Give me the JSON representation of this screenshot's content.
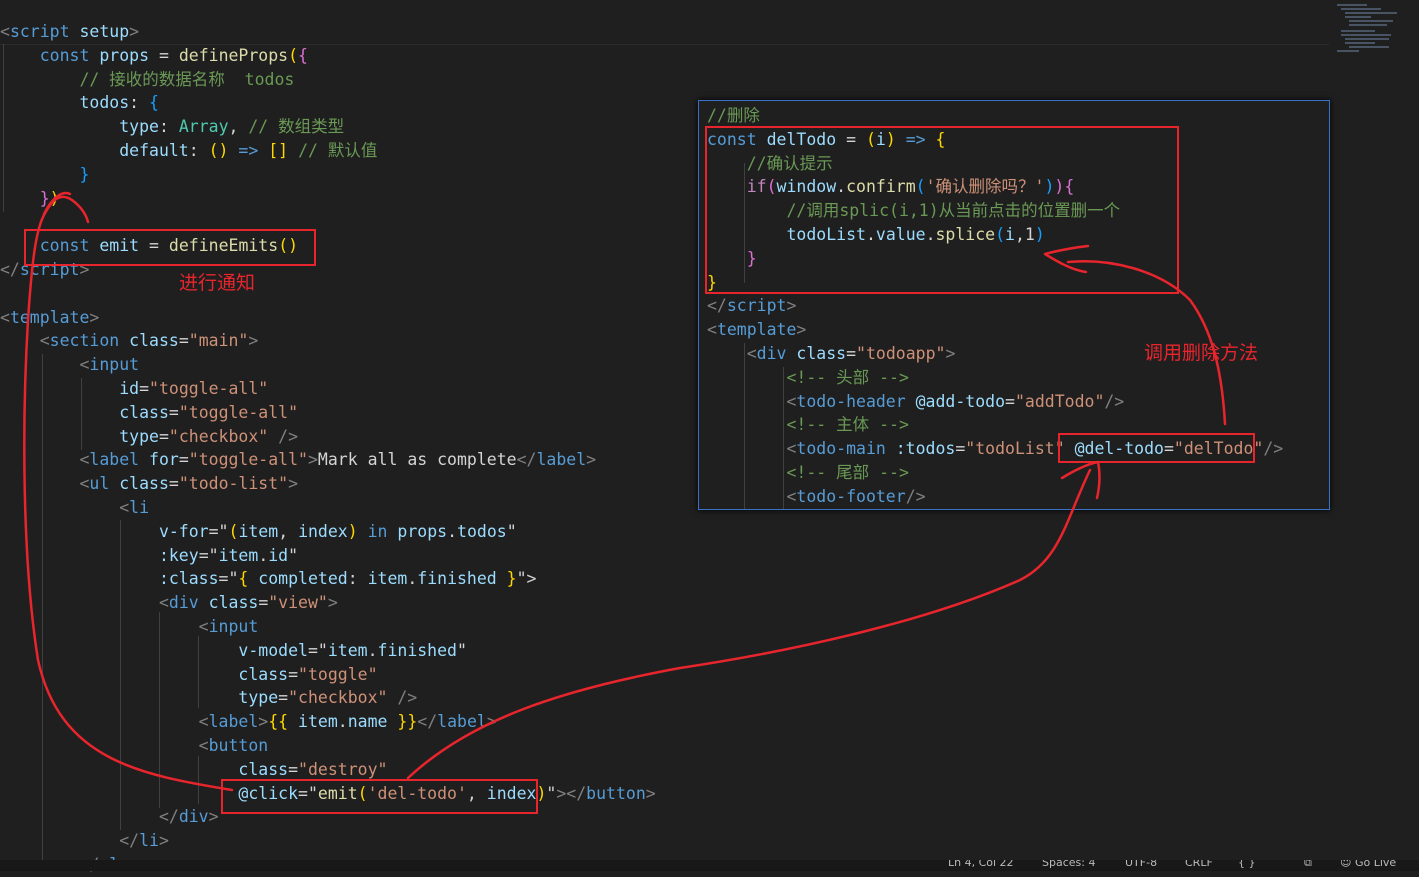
{
  "editor": {
    "lines": [
      [
        [
          "<",
          "c-tag"
        ],
        [
          "script",
          "c-tagname"
        ],
        [
          " ",
          "c-txt"
        ],
        [
          "setup",
          "c-attr"
        ],
        [
          ">",
          "c-tag"
        ]
      ],
      [
        [
          "    const ",
          "c-kw"
        ],
        [
          "props",
          "c-var"
        ],
        [
          " = ",
          "c-txt"
        ],
        [
          "defineProps",
          "c-fn"
        ],
        [
          "(",
          "c-br1"
        ],
        [
          "{",
          "c-br2"
        ]
      ],
      [
        [
          "        // 接收的数据名称  todos",
          "c-com"
        ]
      ],
      [
        [
          "        todos",
          "c-var"
        ],
        [
          ": ",
          "c-txt"
        ],
        [
          "{",
          "c-br3"
        ]
      ],
      [
        [
          "            type",
          "c-var"
        ],
        [
          ": ",
          "c-txt"
        ],
        [
          "Array",
          "c-cls"
        ],
        [
          ", ",
          "c-txt"
        ],
        [
          "// 数组类型",
          "c-com"
        ]
      ],
      [
        [
          "            default",
          "c-var"
        ],
        [
          ": ",
          "c-txt"
        ],
        [
          "()",
          "c-br1"
        ],
        [
          " => ",
          "c-kw"
        ],
        [
          "[]",
          "c-br1"
        ],
        [
          " ",
          "c-txt"
        ],
        [
          "// 默认值",
          "c-com"
        ]
      ],
      [
        [
          "        }",
          "c-br3"
        ]
      ],
      [
        [
          "    }",
          "c-br2"
        ],
        [
          ")",
          "c-br1"
        ]
      ],
      [
        [
          "",
          "c-txt"
        ]
      ],
      [
        [
          "    const ",
          "c-kw"
        ],
        [
          "emit",
          "c-var"
        ],
        [
          " = ",
          "c-txt"
        ],
        [
          "defineEmits",
          "c-fn"
        ],
        [
          "()",
          "c-br1"
        ]
      ],
      [
        [
          "</",
          "c-tag"
        ],
        [
          "script",
          "c-tagname"
        ],
        [
          ">",
          "c-tag"
        ]
      ],
      [
        [
          "",
          "c-txt"
        ]
      ],
      [
        [
          "<",
          "c-tag"
        ],
        [
          "template",
          "c-tagname"
        ],
        [
          ">",
          "c-tag"
        ]
      ],
      [
        [
          "    <",
          "c-tag"
        ],
        [
          "section",
          "c-tagname"
        ],
        [
          " class",
          "c-attr"
        ],
        [
          "=",
          "c-txt"
        ],
        [
          "\"main\"",
          "c-str"
        ],
        [
          ">",
          "c-tag"
        ]
      ],
      [
        [
          "        <",
          "c-tag"
        ],
        [
          "input",
          "c-tagname"
        ]
      ],
      [
        [
          "            id",
          "c-attr"
        ],
        [
          "=",
          "c-txt"
        ],
        [
          "\"toggle-all\"",
          "c-str"
        ]
      ],
      [
        [
          "            class",
          "c-attr"
        ],
        [
          "=",
          "c-txt"
        ],
        [
          "\"toggle-all\"",
          "c-str"
        ]
      ],
      [
        [
          "            type",
          "c-attr"
        ],
        [
          "=",
          "c-txt"
        ],
        [
          "\"checkbox\"",
          "c-str"
        ],
        [
          " />",
          "c-tag"
        ]
      ],
      [
        [
          "        <",
          "c-tag"
        ],
        [
          "label",
          "c-tagname"
        ],
        [
          " for",
          "c-attr"
        ],
        [
          "=",
          "c-txt"
        ],
        [
          "\"toggle-all\"",
          "c-str"
        ],
        [
          ">",
          "c-tag"
        ],
        [
          "Mark all as complete",
          "c-txt"
        ],
        [
          "</",
          "c-tag"
        ],
        [
          "label",
          "c-tagname"
        ],
        [
          ">",
          "c-tag"
        ]
      ],
      [
        [
          "        <",
          "c-tag"
        ],
        [
          "ul",
          "c-tagname"
        ],
        [
          " class",
          "c-attr"
        ],
        [
          "=",
          "c-txt"
        ],
        [
          "\"todo-list\"",
          "c-str"
        ],
        [
          ">",
          "c-tag"
        ]
      ],
      [
        [
          "            <",
          "c-tag"
        ],
        [
          "li",
          "c-tagname"
        ]
      ],
      [
        [
          "                v-for",
          "c-attr"
        ],
        [
          "=\"",
          "c-txt"
        ],
        [
          "(",
          "c-br1"
        ],
        [
          "item",
          "c-var"
        ],
        [
          ", ",
          "c-txt"
        ],
        [
          "index",
          "c-var"
        ],
        [
          ")",
          "c-br1"
        ],
        [
          " in ",
          "c-kw"
        ],
        [
          "props",
          "c-var"
        ],
        [
          ".",
          "c-txt"
        ],
        [
          "todos",
          "c-var"
        ],
        [
          "\"",
          "c-txt"
        ]
      ],
      [
        [
          "                :key",
          "c-attr"
        ],
        [
          "=\"",
          "c-txt"
        ],
        [
          "item",
          "c-var"
        ],
        [
          ".",
          "c-txt"
        ],
        [
          "id",
          "c-var"
        ],
        [
          "\"",
          "c-txt"
        ]
      ],
      [
        [
          "                :class",
          "c-attr"
        ],
        [
          "=\"",
          "c-txt"
        ],
        [
          "{ ",
          "c-br1"
        ],
        [
          "completed",
          "c-var"
        ],
        [
          ": ",
          "c-txt"
        ],
        [
          "item",
          "c-var"
        ],
        [
          ".",
          "c-txt"
        ],
        [
          "finished",
          "c-var"
        ],
        [
          " }",
          "c-br1"
        ],
        [
          "\">",
          "c-txt"
        ]
      ],
      [
        [
          "                <",
          "c-tag"
        ],
        [
          "div",
          "c-tagname"
        ],
        [
          " class",
          "c-attr"
        ],
        [
          "=",
          "c-txt"
        ],
        [
          "\"view\"",
          "c-str"
        ],
        [
          ">",
          "c-tag"
        ]
      ],
      [
        [
          "                    <",
          "c-tag"
        ],
        [
          "input",
          "c-tagname"
        ]
      ],
      [
        [
          "                        v-model",
          "c-attr"
        ],
        [
          "=\"",
          "c-txt"
        ],
        [
          "item",
          "c-var"
        ],
        [
          ".",
          "c-txt"
        ],
        [
          "finished",
          "c-var"
        ],
        [
          "\"",
          "c-txt"
        ]
      ],
      [
        [
          "                        class",
          "c-attr"
        ],
        [
          "=",
          "c-txt"
        ],
        [
          "\"toggle\"",
          "c-str"
        ]
      ],
      [
        [
          "                        type",
          "c-attr"
        ],
        [
          "=",
          "c-txt"
        ],
        [
          "\"checkbox\"",
          "c-str"
        ],
        [
          " />",
          "c-tag"
        ]
      ],
      [
        [
          "                    <",
          "c-tag"
        ],
        [
          "label",
          "c-tagname"
        ],
        [
          ">",
          "c-tag"
        ],
        [
          "{{",
          "c-br1"
        ],
        [
          " item",
          "c-var"
        ],
        [
          ".",
          "c-txt"
        ],
        [
          "name",
          "c-var"
        ],
        [
          " }}",
          "c-br1"
        ],
        [
          "</",
          "c-tag"
        ],
        [
          "label",
          "c-tagname"
        ],
        [
          ">",
          "c-tag"
        ]
      ],
      [
        [
          "                    <",
          "c-tag"
        ],
        [
          "button",
          "c-tagname"
        ]
      ],
      [
        [
          "                        class",
          "c-attr"
        ],
        [
          "=",
          "c-txt"
        ],
        [
          "\"destroy\"",
          "c-str"
        ]
      ],
      [
        [
          "                        @click",
          "c-attr"
        ],
        [
          "=\"",
          "c-txt"
        ],
        [
          "emit",
          "c-fn"
        ],
        [
          "(",
          "c-br1"
        ],
        [
          "'del-todo'",
          "c-str"
        ],
        [
          ", ",
          "c-txt"
        ],
        [
          "index",
          "c-var"
        ],
        [
          ")",
          "c-br1"
        ],
        [
          "\"",
          "c-txt"
        ],
        [
          "></",
          "c-tag"
        ],
        [
          "button",
          "c-tagname"
        ],
        [
          ">",
          "c-tag"
        ]
      ],
      [
        [
          "                </",
          "c-tag"
        ],
        [
          "div",
          "c-tagname"
        ],
        [
          ">",
          "c-tag"
        ]
      ],
      [
        [
          "            </",
          "c-tag"
        ],
        [
          "li",
          "c-tagname"
        ],
        [
          ">",
          "c-tag"
        ]
      ],
      [
        [
          "        </",
          "c-tag"
        ],
        [
          "ul",
          "c-tagname"
        ],
        [
          ">",
          "c-tag"
        ]
      ]
    ]
  },
  "popup": {
    "lines": [
      [
        [
          "//删除",
          "c-com"
        ]
      ],
      [
        [
          "const ",
          "c-kw"
        ],
        [
          "delTodo",
          "c-var"
        ],
        [
          " = ",
          "c-txt"
        ],
        [
          "(",
          "c-br1"
        ],
        [
          "i",
          "c-var"
        ],
        [
          ")",
          "c-br1"
        ],
        [
          " => ",
          "c-kw"
        ],
        [
          "{",
          "c-br1"
        ]
      ],
      [
        [
          "    //确认提示",
          "c-com"
        ]
      ],
      [
        [
          "    if",
          "c-ctl"
        ],
        [
          "(",
          "c-br2"
        ],
        [
          "window",
          "c-var"
        ],
        [
          ".",
          "c-txt"
        ],
        [
          "confirm",
          "c-fn"
        ],
        [
          "(",
          "c-br3"
        ],
        [
          "'确认删除吗？'",
          "c-str"
        ],
        [
          ")",
          "c-br3"
        ],
        [
          ")",
          "c-br2"
        ],
        [
          "{",
          "c-br2"
        ]
      ],
      [
        [
          "        //调用splic(i,1)从当前点击的位置删一个",
          "c-com"
        ]
      ],
      [
        [
          "        todoList",
          "c-var"
        ],
        [
          ".",
          "c-txt"
        ],
        [
          "value",
          "c-var"
        ],
        [
          ".",
          "c-txt"
        ],
        [
          "splice",
          "c-fn"
        ],
        [
          "(",
          "c-br3"
        ],
        [
          "i",
          "c-var"
        ],
        [
          ",",
          "c-txt"
        ],
        [
          "1",
          "c-txt"
        ],
        [
          ")",
          "c-br3"
        ]
      ],
      [
        [
          "    }",
          "c-br2"
        ]
      ],
      [
        [
          "}",
          "c-br1"
        ]
      ],
      [
        [
          "</",
          "c-tag"
        ],
        [
          "script",
          "c-tagname"
        ],
        [
          ">",
          "c-tag"
        ]
      ],
      [
        [
          "<",
          "c-tag"
        ],
        [
          "template",
          "c-tagname"
        ],
        [
          ">",
          "c-tag"
        ]
      ],
      [
        [
          "    <",
          "c-tag"
        ],
        [
          "div",
          "c-tagname"
        ],
        [
          " class",
          "c-attr"
        ],
        [
          "=",
          "c-txt"
        ],
        [
          "\"todoapp\"",
          "c-str"
        ],
        [
          ">",
          "c-tag"
        ]
      ],
      [
        [
          "        <!-- 头部 -->",
          "c-com"
        ]
      ],
      [
        [
          "        <",
          "c-tag"
        ],
        [
          "todo-header",
          "c-tagname"
        ],
        [
          " @add-todo",
          "c-attr"
        ],
        [
          "=",
          "c-txt"
        ],
        [
          "\"addTodo\"",
          "c-str"
        ],
        [
          "/>",
          "c-tag"
        ]
      ],
      [
        [
          "        <!-- 主体 -->",
          "c-com"
        ]
      ],
      [
        [
          "        <",
          "c-tag"
        ],
        [
          "todo-main",
          "c-tagname"
        ],
        [
          " :todos",
          "c-attr"
        ],
        [
          "=",
          "c-txt"
        ],
        [
          "\"todoList\"",
          "c-str"
        ],
        [
          " @del-todo",
          "c-attr"
        ],
        [
          "=",
          "c-txt"
        ],
        [
          "\"delTodo\"",
          "c-str"
        ],
        [
          "/>",
          "c-tag"
        ]
      ],
      [
        [
          "        <!-- 尾部 -->",
          "c-com"
        ]
      ],
      [
        [
          "        <",
          "c-tag"
        ],
        [
          "todo-footer",
          "c-tagname"
        ],
        [
          "/>",
          "c-tag"
        ]
      ]
    ]
  },
  "annotations": {
    "notify": "进行通知",
    "call_delete": "调用删除方法"
  },
  "statusbar": {
    "items": [
      "Ln 4, Col 22",
      "Spaces: 4",
      "UTF-8",
      "CRLF",
      "{ }",
      "⧉",
      "☺ Go Live"
    ]
  },
  "colors": {
    "annotation": "#e8252d",
    "popup_border": "#3a72c7",
    "editor_bg": "#1f1f1f"
  }
}
